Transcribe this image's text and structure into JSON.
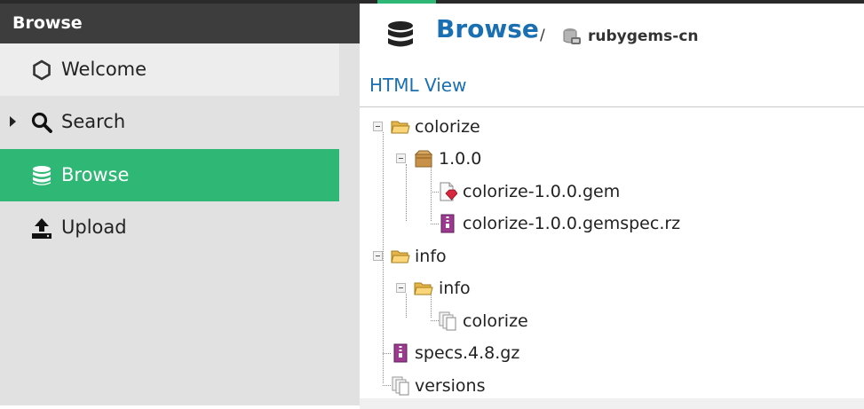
{
  "sidebar": {
    "header": "Browse",
    "items": [
      {
        "label": "Welcome",
        "icon": "hexagon-icon"
      },
      {
        "label": "Search",
        "icon": "search-icon"
      },
      {
        "label": "Browse",
        "icon": "database-icon"
      },
      {
        "label": "Upload",
        "icon": "upload-icon"
      }
    ]
  },
  "main": {
    "title": "Browse",
    "breadcrumb_separator": "/",
    "repository": "rubygems-cn",
    "html_view_link": "HTML View"
  },
  "tree": {
    "nodes": [
      {
        "label": "colorize",
        "type": "folder"
      },
      {
        "label": "1.0.0",
        "type": "package"
      },
      {
        "label": "colorize-1.0.0.gem",
        "type": "gem-file"
      },
      {
        "label": "colorize-1.0.0.gemspec.rz",
        "type": "archive-file"
      },
      {
        "label": "info",
        "type": "folder"
      },
      {
        "label": "info",
        "type": "folder"
      },
      {
        "label": "colorize",
        "type": "file"
      },
      {
        "label": "specs.4.8.gz",
        "type": "archive-file"
      },
      {
        "label": "versions",
        "type": "file"
      }
    ]
  },
  "colors": {
    "accent": "#2fb875",
    "link": "#1a6fb3",
    "sidebar_header": "#3d3d3d"
  }
}
